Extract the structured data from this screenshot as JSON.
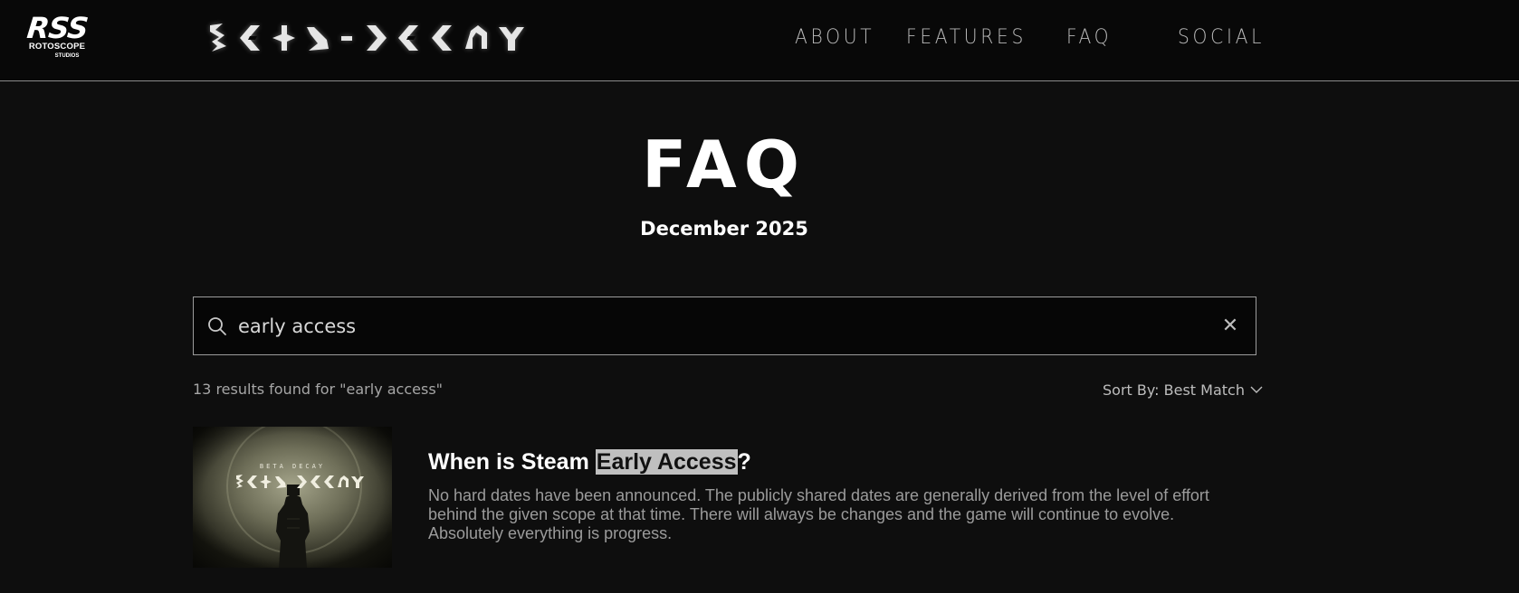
{
  "header": {
    "logo": {
      "main": "RSS",
      "line1": "ROTOSCOPE",
      "line2": "STUDIOS"
    },
    "wordmark": "BETA DECAY",
    "nav": [
      {
        "label": "ABOUT"
      },
      {
        "label": "FEATURES"
      },
      {
        "label": "FAQ"
      },
      {
        "label": "SOCIAL"
      }
    ]
  },
  "hero": {
    "title": "FAQ",
    "date": "December 2025"
  },
  "search": {
    "value": "early access",
    "placeholder": "",
    "icon": "search-icon",
    "clear_icon": "close-icon",
    "clear_glyph": "✕"
  },
  "results": {
    "count_text": "13 results found for \"early access\"",
    "sort_label": "Sort By: Best Match",
    "items": [
      {
        "thumbnail_tagline": "BETA DECAY",
        "title_before": "When is Steam ",
        "title_highlight": "Early Access",
        "title_after": "?",
        "body": "No hard dates have been announced. The publicly shared dates are generally derived from the level of effort behind the given scope at that time. There will always be changes and the game will continue to evolve. Absolutely everything is progress."
      }
    ]
  },
  "colors": {
    "background": "#0e0e0e",
    "header_background": "#080808",
    "nav_text": "#b9b9b9",
    "muted_text": "#9b9b9b",
    "highlight": "#bfbfbf"
  }
}
